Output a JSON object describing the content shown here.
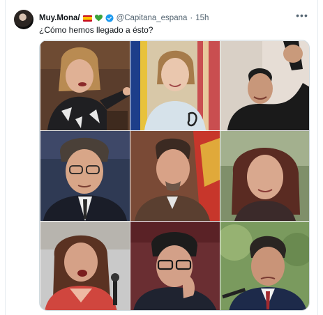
{
  "tweet": {
    "display_name": "Muy.Mona/",
    "name_emojis": [
      "spain-flag-icon",
      "green-heart-icon"
    ],
    "handle": "@Capitana_espana",
    "separator": "·",
    "time": "15h",
    "text": "¿Cómo hemos llegado a ésto?",
    "more_label": "•••"
  },
  "media": {
    "grid": "3x3",
    "photos": [
      {
        "subject": "woman-speaking-pointing"
      },
      {
        "subject": "woman-smiling-flags"
      },
      {
        "subject": "man-raised-fist"
      },
      {
        "subject": "man-glasses-suit"
      },
      {
        "subject": "man-frowning-red-flag"
      },
      {
        "subject": "woman-curly-hair"
      },
      {
        "subject": "woman-shouting-red"
      },
      {
        "subject": "man-glasses-hand-face"
      },
      {
        "subject": "man-suit-frowning"
      }
    ]
  },
  "colors": {
    "text": "#0f1419",
    "secondary": "#536471",
    "verified": "#1d9bf0",
    "border": "#cfd9de"
  }
}
